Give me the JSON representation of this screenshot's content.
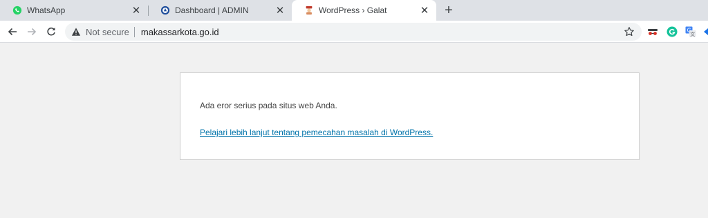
{
  "tabs": [
    {
      "title": "WhatsApp",
      "icon": "whatsapp-icon"
    },
    {
      "title": "Dashboard | ADMIN",
      "icon": "admin-logo-icon"
    },
    {
      "title": "WordPress › Galat",
      "icon": "site-favicon-icon",
      "active": true
    }
  ],
  "toolbar": {
    "security_label": "Not secure",
    "url": "makassarkota.go.id"
  },
  "page": {
    "error_message": "Ada eror serius pada situs web Anda.",
    "help_link": "Pelajari lebih lanjut tentang pemecahan masalah di WordPress."
  },
  "colors": {
    "tabstrip": "#dee1e6",
    "link": "#0073aa",
    "whatsapp": "#25d366",
    "grammarly": "#15c39a"
  }
}
